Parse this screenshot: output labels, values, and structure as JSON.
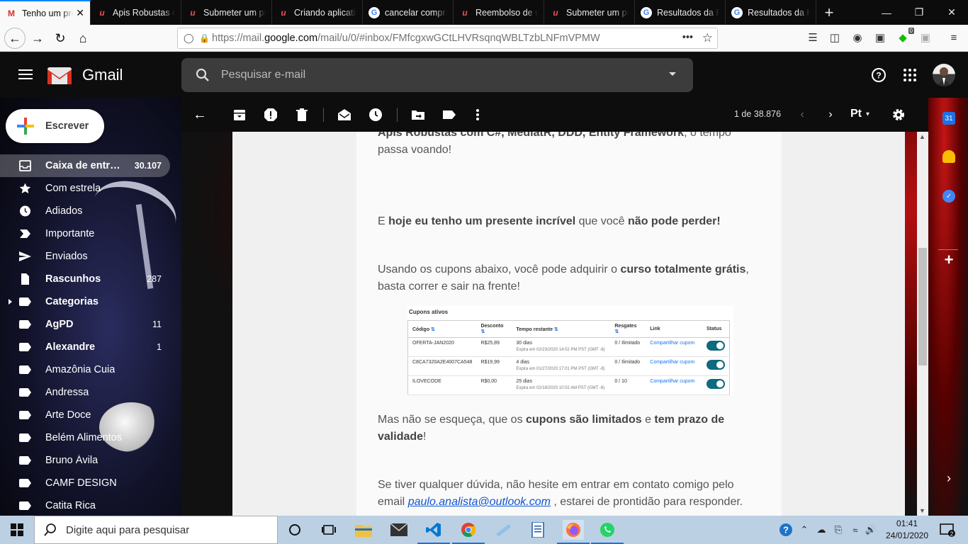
{
  "browser": {
    "tabs": [
      {
        "favicon": "gmail-icon",
        "title": "Tenho um presente",
        "active": true
      },
      {
        "favicon": "udemy-icon",
        "title": "Apis Robustas com"
      },
      {
        "favicon": "udemy-icon",
        "title": "Submeter um pedido"
      },
      {
        "favicon": "udemy-icon",
        "title": "Criando aplicativos"
      },
      {
        "favicon": "google-icon",
        "title": "cancelar compra"
      },
      {
        "favicon": "udemy-icon",
        "title": "Reembolso de um"
      },
      {
        "favicon": "udemy-icon",
        "title": "Submeter um pedido"
      },
      {
        "favicon": "google-icon",
        "title": "Resultados da Pesquisa"
      },
      {
        "favicon": "google-icon",
        "title": "Resultados da Pesquisa"
      }
    ],
    "url_prefix": "https://mail.",
    "url_host": "google.com",
    "url_path": "/mail/u/0/#inbox/FMfcgxwGCtLHVRsqnqWBLTzbLNFmVPMW",
    "url_more": "•••",
    "badge_count": "0"
  },
  "gmail": {
    "app_name": "Gmail",
    "search_placeholder": "Pesquisar e-mail",
    "compose_label": "Escrever",
    "folders": [
      {
        "name": "Caixa de entra...",
        "count": "30.107",
        "icon": "inbox-icon",
        "active": true,
        "bold": true
      },
      {
        "name": "Com estrela",
        "count": "",
        "icon": "star-icon"
      },
      {
        "name": "Adiados",
        "count": "",
        "icon": "clock-icon"
      },
      {
        "name": "Importante",
        "count": "",
        "icon": "important-icon"
      },
      {
        "name": "Enviados",
        "count": "",
        "icon": "send-icon"
      },
      {
        "name": "Rascunhos",
        "count": "287",
        "icon": "draft-icon",
        "bold": true
      },
      {
        "name": "Categorias",
        "count": "",
        "icon": "label-icon",
        "bold": true,
        "expandable": true
      },
      {
        "name": "AgPD",
        "count": "11",
        "icon": "label-icon",
        "bold": true
      },
      {
        "name": "Alexandre",
        "count": "1",
        "icon": "label-icon",
        "bold": true
      },
      {
        "name": "Amazônia Cuia",
        "count": "",
        "icon": "label-icon"
      },
      {
        "name": "Andressa",
        "count": "",
        "icon": "label-icon"
      },
      {
        "name": "Arte Doce",
        "count": "",
        "icon": "label-icon"
      },
      {
        "name": "Belém Alimentos",
        "count": "",
        "icon": "label-icon"
      },
      {
        "name": "Bruno Ávila",
        "count": "",
        "icon": "label-icon"
      },
      {
        "name": "CAMF DESIGN",
        "count": "",
        "icon": "label-icon"
      },
      {
        "name": "Catita Rica",
        "count": "",
        "icon": "label-icon"
      }
    ],
    "pager": "1 de 38.876",
    "input_tool": "Pt"
  },
  "message": {
    "p0_bold": "Apis Robustas com C#, MediatR, DDD, Entity Framework",
    "p0_text": ", o tempo passa voando!",
    "p1_a": "E ",
    "p1_b1": "hoje eu tenho um presente incrível",
    "p1_c": " que você ",
    "p1_b2": "não pode perder!",
    "p2_a": "Usando os cupons abaixo, você pode adquirir o ",
    "p2_b": "curso totalmente grátis",
    "p2_c": ", basta correr e sair na frente!",
    "p3_a": "Mas não se esqueça, que os ",
    "p3_b1": "cupons são limitados",
    "p3_c": " e ",
    "p3_b2": "tem prazo de validade",
    "p3_d": "!",
    "p4_a": "Se tiver qualquer dúvida, não hesite em entrar em contato comigo pelo email ",
    "p4_link": "paulo.analista@outlook.com",
    "p4_b": " , estarei de prontidão para responder.",
    "coupons": {
      "title": "Cupons ativos",
      "headers": [
        "Código",
        "Desconto",
        "Tempo restante",
        "Resgates",
        "Link",
        "Status"
      ],
      "rows": [
        {
          "code": "OFERTA-JAN2020",
          "discount": "R$25,89",
          "time": "30 dias",
          "expires": "Expira em 02/23/2020 14:02 PM PST (GMT -8)",
          "redeemed": "0 / Ilimitado",
          "link": "Compartilhar cupom"
        },
        {
          "code": "C8CA7320A2E4007CA548",
          "discount": "R$19,99",
          "time": "4 dias",
          "expires": "Expira em 01/27/2020 17:01 PM PST (GMT -8)",
          "redeemed": "0 / Ilimitado",
          "link": "Compartilhar cupom"
        },
        {
          "code": "ILOVECODE",
          "discount": "R$0,00",
          "time": "25 dias",
          "expires": "Expira em 02/18/2020 10:02 AM PST (GMT -8)",
          "redeemed": "0 / 10",
          "link": "Compartilhar cupom"
        }
      ]
    }
  },
  "taskbar": {
    "search_placeholder": "Digite aqui para pesquisar",
    "time": "01:41",
    "date": "24/01/2020",
    "notification_count": "2"
  },
  "colors": {
    "gmail_red": "#d93025",
    "link_blue": "#1155cc",
    "toggle_teal": "#0e6a7e",
    "firefox_accent": "#0a84ff"
  }
}
